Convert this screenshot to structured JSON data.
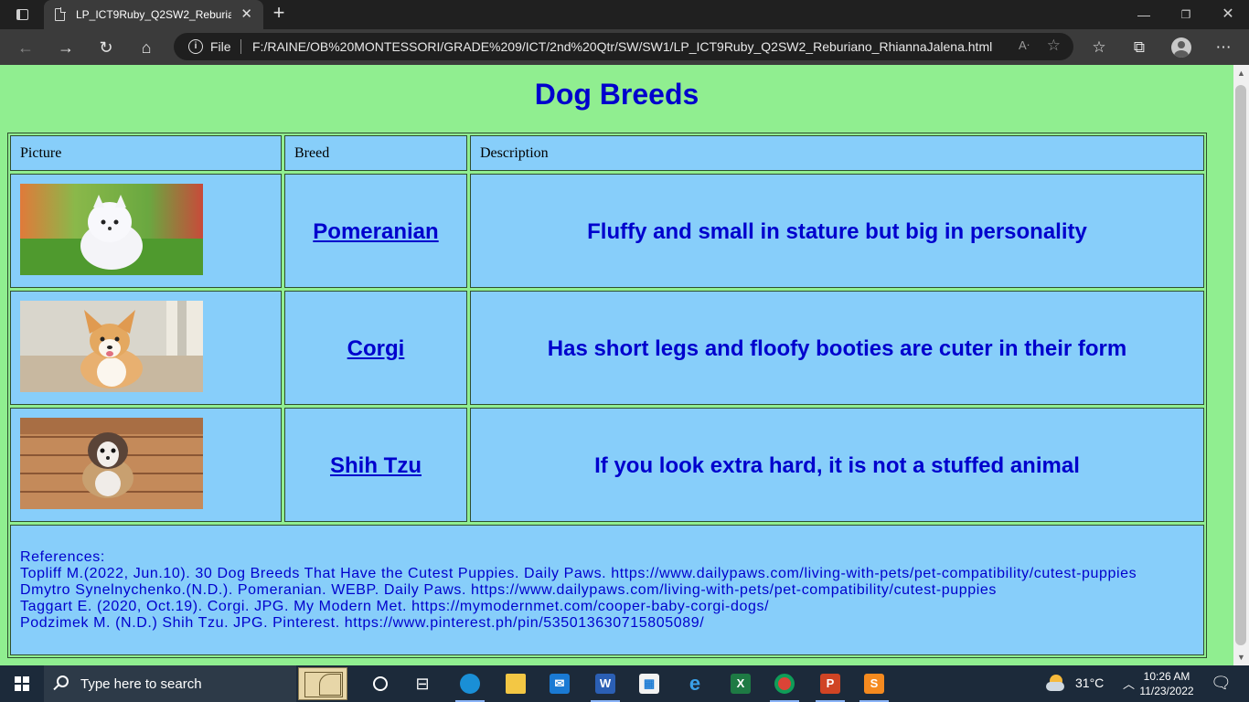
{
  "browser": {
    "tab_title": "LP_ICT9Ruby_Q2SW2_Reburiano_RhiannaJalena.html",
    "file_label": "File",
    "url": "F:/RAINE/OB%20MONTESSORI/GRADE%209/ICT/2nd%20Qtr/SW/SW1/LP_ICT9Ruby_Q2SW2_Reburiano_RhiannaJalena.html"
  },
  "page": {
    "title": "Dog Breeds",
    "headers": {
      "picture": "Picture",
      "breed": "Breed",
      "description": "Description"
    },
    "rows": [
      {
        "breed": "Pomeranian",
        "description": "Fluffy and small in stature but big in personality",
        "image_icon": "pomeranian-photo"
      },
      {
        "breed": "Corgi",
        "description": "Has short legs and floofy booties are cuter in their form",
        "image_icon": "corgi-photo"
      },
      {
        "breed": "Shih Tzu",
        "description": "If you look extra hard, it is not a stuffed animal",
        "image_icon": "shih-tzu-photo"
      }
    ],
    "references": {
      "label": "References:",
      "lines": [
        "Topliff M.(2022, Jun.10). 30 Dog Breeds That Have the Cutest Puppies. Daily Paws. https://www.dailypaws.com/living-with-pets/pet-compatibility/cutest-puppies",
        "Dmytro Synelnychenko.(N.D.). Pomeranian. WEBP. Daily Paws. https://www.dailypaws.com/living-with-pets/pet-compatibility/cutest-puppies",
        "Taggart E. (2020, Oct.19). Corgi. JPG. My Modern Met. https://mymodernmet.com/cooper-baby-corgi-dogs/",
        "Podzimek M. (N.D.) Shih Tzu. JPG. Pinterest. https://www.pinterest.ph/pin/535013630715805089/"
      ]
    }
  },
  "colors": {
    "page_background": "#90ee90",
    "cell_background": "#87cefa",
    "text_blue": "#0000cd"
  },
  "taskbar": {
    "search_placeholder": "Type here to search",
    "temperature": "31°C",
    "time": "10:26 AM",
    "date": "11/23/2022"
  }
}
